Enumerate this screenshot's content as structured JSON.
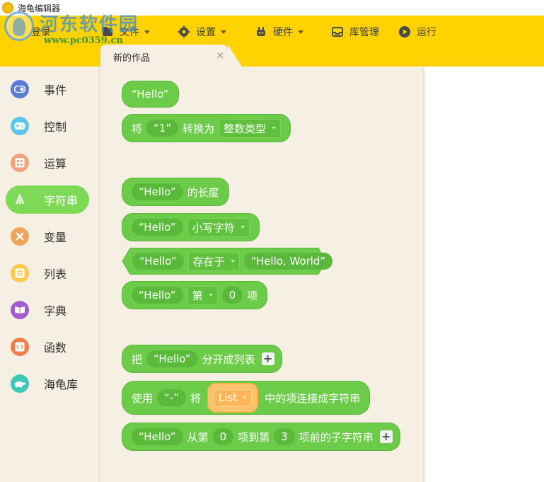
{
  "window": {
    "title": "海龟编辑器"
  },
  "watermark": {
    "text": "河东软件园",
    "url": "www.pc0359.cn"
  },
  "toolbar": {
    "login": "登录",
    "file": "文件",
    "settings": "设置",
    "hardware": "硬件",
    "library": "库管理",
    "run": "运行"
  },
  "tab": {
    "label": "新的作品",
    "close": "×"
  },
  "sidebar": {
    "items": [
      {
        "label": "事件",
        "color": "#5b7bd5"
      },
      {
        "label": "控制",
        "color": "#5ec4e8"
      },
      {
        "label": "运算",
        "color": "#f0a37c"
      },
      {
        "label": "字符串",
        "color": "#7ed957"
      },
      {
        "label": "变量",
        "color": "#f0a35a"
      },
      {
        "label": "列表",
        "color": "#ffc94d"
      },
      {
        "label": "字典",
        "color": "#a35bd0"
      },
      {
        "label": "函数",
        "color": "#f07f4f"
      },
      {
        "label": "海龟库",
        "color": "#3fc8b8"
      }
    ]
  },
  "blocks": {
    "b1": {
      "str": "“Hello”"
    },
    "b2": {
      "t1": "将",
      "v": "“1”",
      "t2": "转换为",
      "drop": "整数类型"
    },
    "b3": {
      "str": "“Hello”",
      "t": "的长度"
    },
    "b4": {
      "str": "“Hello”",
      "drop": "小写字符"
    },
    "b5": {
      "str": "“Hello”",
      "drop": "存在于",
      "str2": "“Hello, World”"
    },
    "b6": {
      "str": "“Hello”",
      "drop": "第",
      "num": "0",
      "t": "项"
    },
    "b7": {
      "t1": "把",
      "str": "“Hello”",
      "t2": "分开成列表",
      "plus": "+"
    },
    "b8": {
      "t1": "使用",
      "sep": "“-”",
      "t2": "将",
      "list": "List",
      "t3": "中的项连接成字符串"
    },
    "b9": {
      "str": "“Hello”",
      "t1": "从第",
      "n1": "0",
      "t2": "项到第",
      "n2": "3",
      "t3": "项前的子字符串",
      "plus": "+"
    }
  }
}
